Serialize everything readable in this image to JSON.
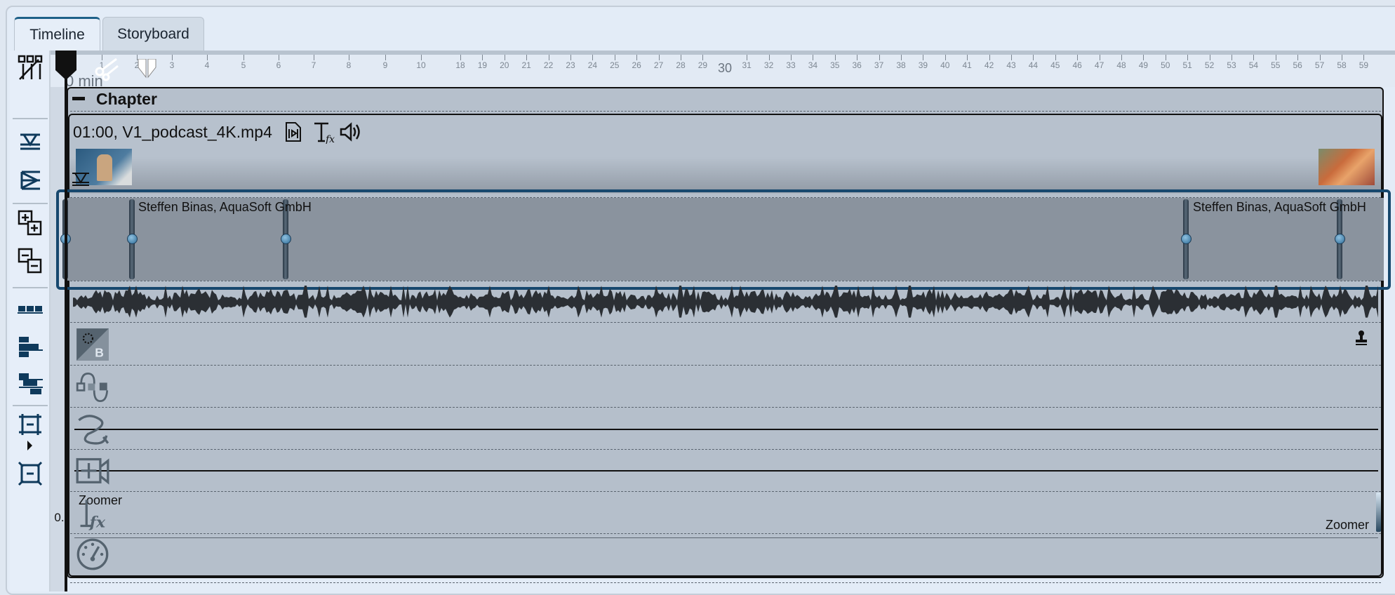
{
  "tabs": [
    {
      "label": "Timeline",
      "active": true
    },
    {
      "label": "Storyboard",
      "active": false
    }
  ],
  "toolbar": {
    "icons": [
      "remove-gaps-icon",
      "insert-above-icon",
      "insert-below-icon",
      "add-tracks-icon",
      "remove-tracks-icon",
      "align-clips-icon",
      "align-left-icon",
      "align-center-icon",
      "collapse-tracks-icon",
      "expand-tracks-icon"
    ]
  },
  "ruler": {
    "unit_label": "0 min",
    "major_label": "30",
    "labels_a": [
      "1",
      "2",
      "3",
      "4",
      "5",
      "6",
      "7",
      "8",
      "9",
      "10"
    ],
    "labels_b": [
      "18",
      "19",
      "20",
      "21",
      "22",
      "23",
      "24",
      "25",
      "26",
      "27",
      "28",
      "29",
      "31",
      "32",
      "33",
      "34",
      "35",
      "36",
      "37",
      "38",
      "39",
      "40",
      "41",
      "42",
      "43",
      "44",
      "45",
      "46",
      "47",
      "48",
      "49",
      "50",
      "51",
      "52",
      "53",
      "54",
      "55",
      "56",
      "57",
      "58",
      "59"
    ]
  },
  "chapter": {
    "title": "Chapter",
    "collapse_symbol": "−"
  },
  "clip": {
    "title": "01:00, V1_podcast_4K.mp4",
    "icons": [
      "video-file-icon",
      "text-effect-icon",
      "audio-icon"
    ]
  },
  "text_track": {
    "captions": [
      "Steffen Binas, AquaSoft GmbH",
      "Steffen Binas, AquaSoft GmbH"
    ]
  },
  "rows": {
    "icons": [
      "color-correction-icon",
      "keyframe-curve-icon",
      "motion-path-icon",
      "camera-pan-icon",
      "text-fx-icon",
      "speed-icon"
    ]
  },
  "zoomer": {
    "left_label": "Zoomer",
    "right_label": "Zoomer",
    "value": "0..."
  },
  "colors": {
    "accent": "#17486e",
    "selection_border": "#17486e",
    "track_bg": "#b6c0cc"
  }
}
